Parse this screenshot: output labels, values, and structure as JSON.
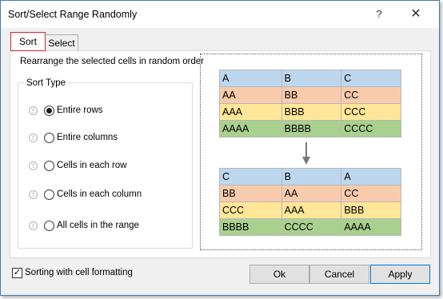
{
  "window": {
    "title": "Sort/Select Range Randomly",
    "help_label": "?",
    "close_label": "✕"
  },
  "tabs": [
    {
      "label": "Sort",
      "selected": true
    },
    {
      "label": "Select",
      "selected": false
    }
  ],
  "description": "Rearrange the selected cells in random order",
  "sort_type": {
    "label": "Sort Type",
    "options": [
      {
        "label": "Entire rows",
        "selected": true
      },
      {
        "label": "Entire columns",
        "selected": false
      },
      {
        "label": "Cells in each row",
        "selected": false
      },
      {
        "label": "Cells in each column",
        "selected": false
      },
      {
        "label": "All cells in the range",
        "selected": false
      }
    ],
    "info_icon_glyph": "!"
  },
  "preview": {
    "before": [
      [
        "A",
        "B",
        "C"
      ],
      [
        "AA",
        "BB",
        "CC"
      ],
      [
        "AAA",
        "BBB",
        "CCC"
      ],
      [
        "AAAA",
        "BBBB",
        "CCCC"
      ]
    ],
    "after": [
      [
        "C",
        "B",
        "A"
      ],
      [
        "BB",
        "AA",
        "CC"
      ],
      [
        "CCC",
        "AAA",
        "BBB"
      ],
      [
        "BBBB",
        "CCCC",
        "AAAA"
      ]
    ],
    "row_colors": [
      "#bdd7ee",
      "#f8cbad",
      "#ffe699",
      "#a9d08e"
    ]
  },
  "footer": {
    "checkbox_label": "Sorting with cell formatting",
    "checkbox_checked": true,
    "checkbox_glyph": "✓",
    "ok_label": "Ok",
    "cancel_label": "Cancel",
    "apply_label": "Apply"
  }
}
